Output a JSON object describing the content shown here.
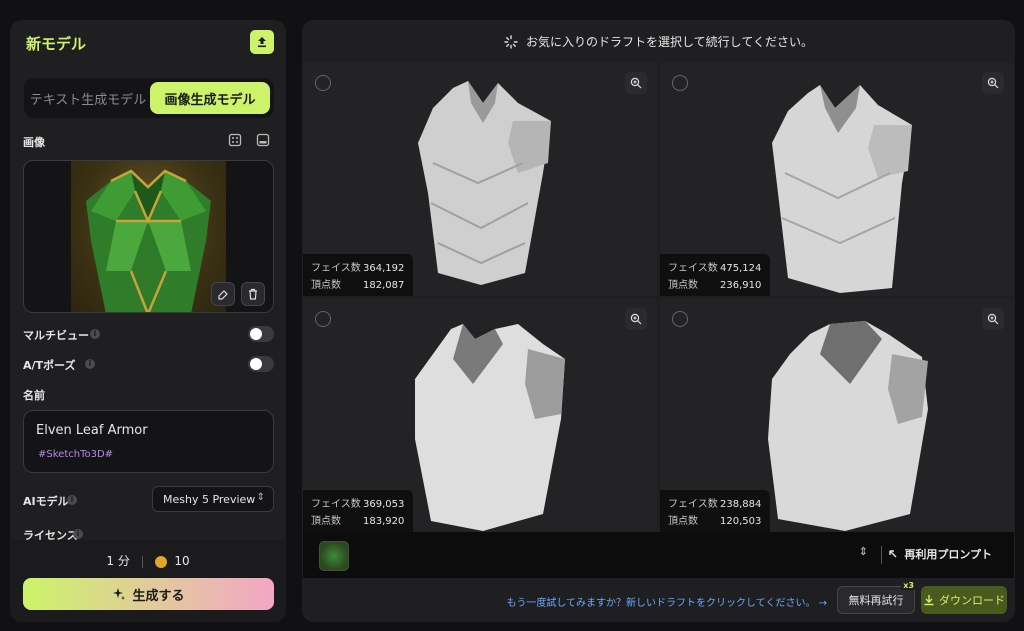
{
  "left_panel": {
    "title": "新モデル",
    "tabs": [
      {
        "label": "テキスト生成モデル",
        "active": false
      },
      {
        "label": "画像生成モデル",
        "active": true
      }
    ],
    "image_label": "画像",
    "multiview_label": "マルチビュー",
    "multiview_enabled": false,
    "atpose_label": "A/Tポーズ",
    "atpose_enabled": false,
    "name_label": "名前",
    "name_value": "Elven Leaf Armor",
    "name_tag": "#SketchTo3D#",
    "ai_model_label": "AIモデル",
    "ai_model_value": "Meshy 5 Preview",
    "license_label": "ライセンス",
    "time_estimate": "1 分",
    "credits": "10",
    "generate_label": "生成する"
  },
  "right_panel": {
    "header_text": "お気に入りのドラフトを選択して続行してください。",
    "drafts": [
      {
        "faces_label": "フェイス数",
        "faces": "364,192",
        "verts_label": "頂点数",
        "verts": "182,087"
      },
      {
        "faces_label": "フェイス数",
        "faces": "475,124",
        "verts_label": "頂点数",
        "verts": "236,910"
      },
      {
        "faces_label": "フェイス数",
        "faces": "369,053",
        "verts_label": "頂点数",
        "verts": "183,920"
      },
      {
        "faces_label": "フェイス数",
        "faces": "238,884",
        "verts_label": "頂点数",
        "verts": "120,503"
      }
    ],
    "reuse_prompt_label": "再利用プロンプト",
    "retry_text": "もう一度試してみますか？新しいドラフトをクリックしてください。 →",
    "free_retry_label": "無料再試行",
    "free_retry_badge": "x3",
    "download_label": "ダウンロード"
  },
  "colors": {
    "accent": "#cdf36a",
    "panel": "#1f1f22",
    "background": "#111113",
    "link": "#6aa8ff"
  }
}
